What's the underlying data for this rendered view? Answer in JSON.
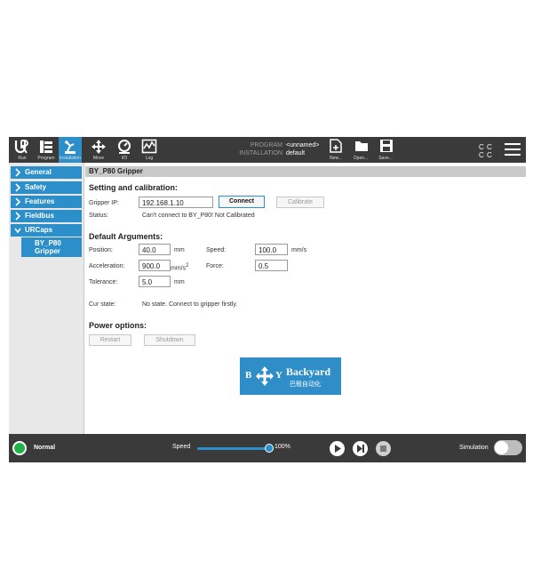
{
  "topbar": {
    "nav": [
      {
        "label": "Run",
        "icon": "ur-logo-icon"
      },
      {
        "label": "Program",
        "icon": "program-icon"
      },
      {
        "label": "Installation",
        "icon": "installation-icon",
        "active": true
      },
      {
        "label": "Move",
        "icon": "move-icon"
      },
      {
        "label": "I/O",
        "icon": "io-icon"
      },
      {
        "label": "Log",
        "icon": "log-icon"
      }
    ],
    "program_key": "PROGRAM",
    "program_value": "<unnamed>",
    "installation_key": "INSTALLATION",
    "installation_value": "default",
    "file_buttons": [
      {
        "label": "New...",
        "icon": "new-file-icon"
      },
      {
        "label": "Open...",
        "icon": "open-folder-icon"
      },
      {
        "label": "Save...",
        "icon": "save-icon"
      }
    ],
    "cc_icon": "cc-icon",
    "menu_icon": "hamburger-menu-icon",
    "accent_color": "#2d8fc9"
  },
  "sidebar": {
    "items": [
      {
        "label": "General",
        "expanded": false
      },
      {
        "label": "Safety",
        "expanded": false
      },
      {
        "label": "Features",
        "expanded": false
      },
      {
        "label": "Fieldbus",
        "expanded": false
      },
      {
        "label": "URCaps",
        "expanded": true
      }
    ],
    "sub_item": "BY_P80 Gripper"
  },
  "content": {
    "title": "BY_P80 Gripper",
    "setting_heading": "Setting and calibration:",
    "gripper_ip_label": "Gripper IP:",
    "gripper_ip_value": "192.168.1.10",
    "connect_label": "Connect",
    "calibrate_label": "Calibrate",
    "status_label": "Status:",
    "status_value": "Can't connect to BY_P80!  Not Calibrated",
    "default_heading": "Default Arguments:",
    "position_label": "Position:",
    "position_value": "40.0",
    "position_unit": "mm",
    "speed_label": "Speed:",
    "speed_value": "100.0",
    "speed_unit": "mm/s",
    "acceleration_label": "Acceleration:",
    "acceleration_value": "900.0",
    "acceleration_unit": "mm/s",
    "acceleration_unit_exp": "2",
    "force_label": "Force:",
    "force_value": "0.5",
    "tolerance_label": "Tolerance:",
    "tolerance_value": "5.0",
    "tolerance_unit": "mm",
    "cur_state_label": "Cur state:",
    "cur_state_value": "No state. Connect to gripper firstly.",
    "power_heading": "Power options:",
    "restart_label": "Restart",
    "shutdown_label": "Shutdown",
    "logo_text_1": "B",
    "logo_text_2": "Y",
    "logo_brand": "Backyard",
    "logo_sub": "巴彀自动化"
  },
  "bottombar": {
    "status": "Normal",
    "status_color": "#22b24c",
    "speed_label": "Speed",
    "speed_value": "100%",
    "speed_fraction": 1.0,
    "simulation_label": "Simulation",
    "simulation_on": false
  }
}
